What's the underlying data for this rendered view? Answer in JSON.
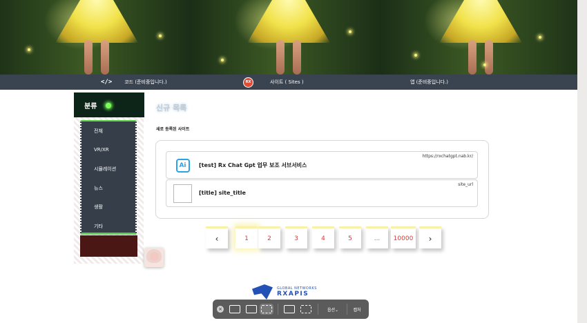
{
  "nav": {
    "code_label": "코드 (준비중입니다.)",
    "code_icon": "</>",
    "sites_label": "사이트 ( Sites )",
    "rx_icon": "RX",
    "app_label": "앱 (준비중입니다.)"
  },
  "sidebar": {
    "title": "분류",
    "items": [
      {
        "label": "전체"
      },
      {
        "label": "VR/XR"
      },
      {
        "label": "시뮬레이션"
      },
      {
        "label": "뉴스"
      },
      {
        "label": "생활"
      },
      {
        "label": "기타"
      }
    ]
  },
  "main": {
    "heading": "신규 목록",
    "subheading": "새로 등록된 사이트",
    "sites": [
      {
        "title": "[test] Rx Chat Gpt 업무 보조 서브서비스",
        "url": "https://rxchatgpt.nab.kr/",
        "icon": "Ai"
      },
      {
        "title": "[title] site_title",
        "url": "site_url"
      }
    ]
  },
  "pagination": {
    "prev": "‹",
    "pages": [
      "1",
      "2",
      "3",
      "4",
      "5",
      "...",
      "10000"
    ],
    "next": "›",
    "active_page": "1"
  },
  "footer": {
    "logo_top": "GLOBAL NETWORKS",
    "logo_main": "RXAPIS"
  },
  "capture_toolbar": {
    "close": "×",
    "options": "옵션⌄",
    "capture": "캡처"
  }
}
